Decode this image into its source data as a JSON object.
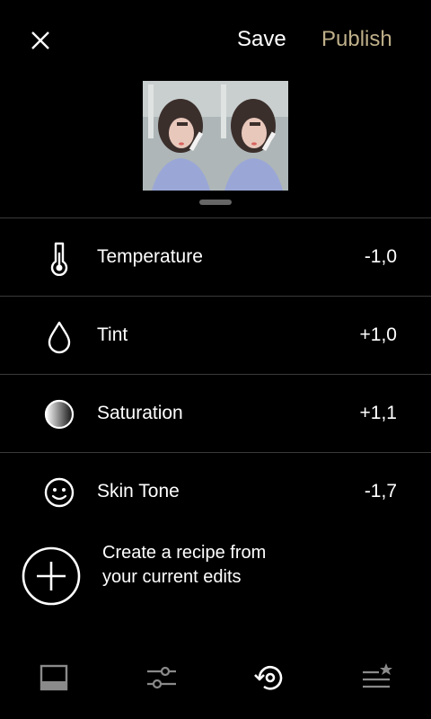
{
  "colors": {
    "accent": "#bfb08a",
    "divider": "#3a3a3a",
    "inactive_icon": "#8a8a8a"
  },
  "header": {
    "save_label": "Save",
    "publish_label": "Publish"
  },
  "preview": {
    "thumbnails": 2
  },
  "adjustments": [
    {
      "icon": "thermometer-icon",
      "label": "Temperature",
      "value": "-1,0"
    },
    {
      "icon": "droplet-icon",
      "label": "Tint",
      "value": "+1,0"
    },
    {
      "icon": "saturation-circle-icon",
      "label": "Saturation",
      "value": "+1,1"
    },
    {
      "icon": "smiley-face-icon",
      "label": "Skin Tone",
      "value": "-1,7"
    }
  ],
  "recipe": {
    "text": "Create a recipe from your current edits"
  },
  "bottom_nav": [
    {
      "icon": "presets-icon",
      "active": false
    },
    {
      "icon": "adjust-sliders-icon",
      "active": false
    },
    {
      "icon": "history-undo-icon",
      "active": true
    },
    {
      "icon": "recipes-star-icon",
      "active": false
    }
  ]
}
